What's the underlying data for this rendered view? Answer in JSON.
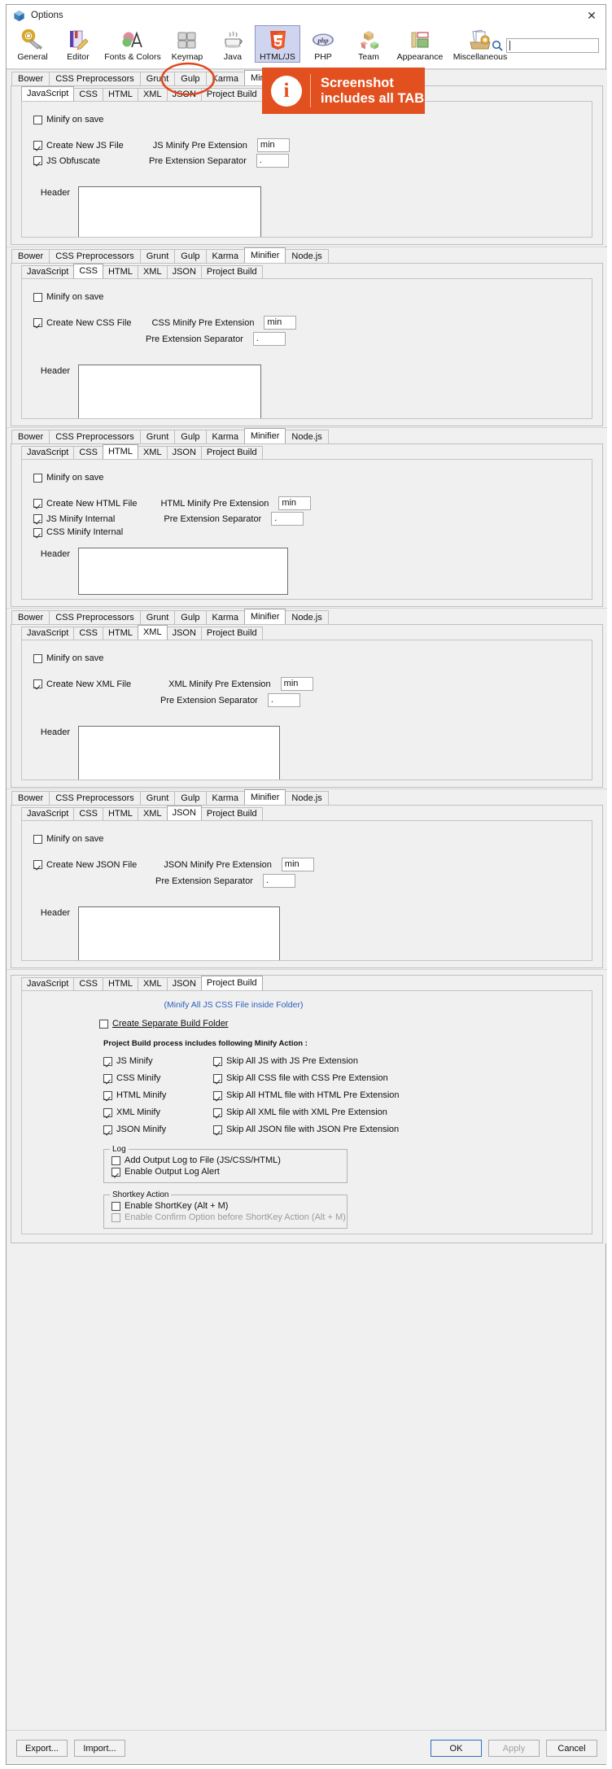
{
  "window": {
    "title": "Options",
    "title_icon": "options-logo-icon",
    "close_label": "✕"
  },
  "toolbar": {
    "categories": [
      {
        "label": "General",
        "icon": "gear-wrench-icon"
      },
      {
        "label": "Editor",
        "icon": "book-pencil-icon"
      },
      {
        "label": "Fonts & Colors",
        "icon": "palette-letter-icon"
      },
      {
        "label": "Keymap",
        "icon": "keyboard-keys-icon"
      },
      {
        "label": "Java",
        "icon": "coffee-cup-icon"
      },
      {
        "label": "HTML/JS",
        "icon": "html5-shield-icon",
        "selected": true
      },
      {
        "label": "PHP",
        "icon": "php-elephant-icon"
      },
      {
        "label": "Team",
        "icon": "cubes-icon"
      },
      {
        "label": "Appearance",
        "icon": "layout-panels-icon"
      },
      {
        "label": "Miscellaneous",
        "icon": "documents-gear-icon"
      }
    ],
    "search": {
      "icon": "search-icon",
      "value": "",
      "placeholder": ""
    }
  },
  "banner": {
    "icon": "info-circle-icon",
    "line1": "Screenshot",
    "line2": "includes all TAB",
    "color": "#e3501f"
  },
  "outer_tabs": [
    "Bower",
    "CSS Preprocessors",
    "Grunt",
    "Gulp",
    "Karma",
    "Minifier",
    "Node.js"
  ],
  "outer_active": "Minifier",
  "inner_tabs": [
    "JavaScript",
    "CSS",
    "HTML",
    "XML",
    "JSON",
    "Project Build"
  ],
  "panels": [
    {
      "id": "javascript",
      "active_tab": "JavaScript",
      "minify_on_save": {
        "label": "Minify on save",
        "checked": false
      },
      "checks": [
        {
          "label": "Create New JS File",
          "checked": true
        },
        {
          "label": "JS Obfuscate",
          "checked": true
        }
      ],
      "fields": [
        {
          "label": "JS Minify Pre Extension",
          "value": "min"
        },
        {
          "label": "Pre Extension Separator",
          "value": "."
        }
      ],
      "header": {
        "label": "Header",
        "value": ""
      }
    },
    {
      "id": "css",
      "active_tab": "CSS",
      "minify_on_save": {
        "label": "Minify on save",
        "checked": false
      },
      "checks": [
        {
          "label": "Create New CSS File",
          "checked": true
        }
      ],
      "fields": [
        {
          "label": "CSS Minify Pre Extension",
          "value": "min"
        },
        {
          "label": "Pre Extension Separator",
          "value": "."
        }
      ],
      "header": {
        "label": "Header",
        "value": ""
      }
    },
    {
      "id": "html",
      "active_tab": "HTML",
      "minify_on_save": {
        "label": "Minify on save",
        "checked": false
      },
      "checks": [
        {
          "label": "Create New HTML File",
          "checked": true
        },
        {
          "label": "JS Minify Internal",
          "checked": true
        },
        {
          "label": "CSS Minify Internal",
          "checked": true
        }
      ],
      "fields": [
        {
          "label": "HTML Minify Pre Extension",
          "value": "min"
        },
        {
          "label": "Pre Extension Separator",
          "value": "."
        }
      ],
      "header": {
        "label": "Header",
        "value": ""
      }
    },
    {
      "id": "xml",
      "active_tab": "XML",
      "minify_on_save": {
        "label": "Minify on save",
        "checked": false
      },
      "checks": [
        {
          "label": "Create New XML File",
          "checked": true
        }
      ],
      "fields": [
        {
          "label": "XML Minify Pre Extension",
          "value": "min"
        },
        {
          "label": "Pre Extension Separator",
          "value": "."
        }
      ],
      "header": {
        "label": "Header",
        "value": ""
      }
    },
    {
      "id": "json",
      "active_tab": "JSON",
      "minify_on_save": {
        "label": "Minify on save",
        "checked": false
      },
      "checks": [
        {
          "label": "Create New JSON File",
          "checked": true
        }
      ],
      "fields": [
        {
          "label": "JSON Minify Pre Extension",
          "value": "min"
        },
        {
          "label": "Pre Extension Separator",
          "value": "."
        }
      ],
      "header": {
        "label": "Header",
        "value": ""
      }
    }
  ],
  "project_build": {
    "active_tab": "Project Build",
    "link": "(Minify All JS CSS File inside Folder)",
    "separate_folder": {
      "label": "Create Separate Build Folder",
      "checked": false
    },
    "section_title": "Project Build process includes following Minify Action :",
    "left_checks": [
      {
        "label": "JS Minify",
        "checked": true
      },
      {
        "label": "CSS Minify",
        "checked": true
      },
      {
        "label": "HTML Minify",
        "checked": true
      },
      {
        "label": "XML Minify",
        "checked": true
      },
      {
        "label": "JSON Minify",
        "checked": true
      }
    ],
    "right_checks": [
      {
        "label": "Skip All JS with JS Pre Extension",
        "checked": true
      },
      {
        "label": "Skip All CSS file with CSS Pre Extension",
        "checked": true
      },
      {
        "label": "Skip All HTML file with HTML Pre Extension",
        "checked": true
      },
      {
        "label": "Skip All XML file with XML Pre Extension",
        "checked": true
      },
      {
        "label": "Skip All JSON file with JSON Pre Extension",
        "checked": true
      }
    ],
    "log_group": {
      "title": "Log",
      "checks": [
        {
          "label": "Add Output Log to File (JS/CSS/HTML)",
          "checked": false
        },
        {
          "label": "Enable Output Log Alert",
          "checked": true
        }
      ]
    },
    "shortkey_group": {
      "title": "Shortkey Action",
      "checks": [
        {
          "label": "Enable ShortKey (Alt + M)",
          "checked": false,
          "disabled": false
        },
        {
          "label": "Enable Confirm Option before ShortKey Action (Alt + M)",
          "checked": false,
          "disabled": true
        }
      ]
    }
  },
  "bottom_bar": {
    "export_label": "Export...",
    "import_label": "Import...",
    "ok_label": "OK",
    "apply_label": "Apply",
    "cancel_label": "Cancel"
  }
}
